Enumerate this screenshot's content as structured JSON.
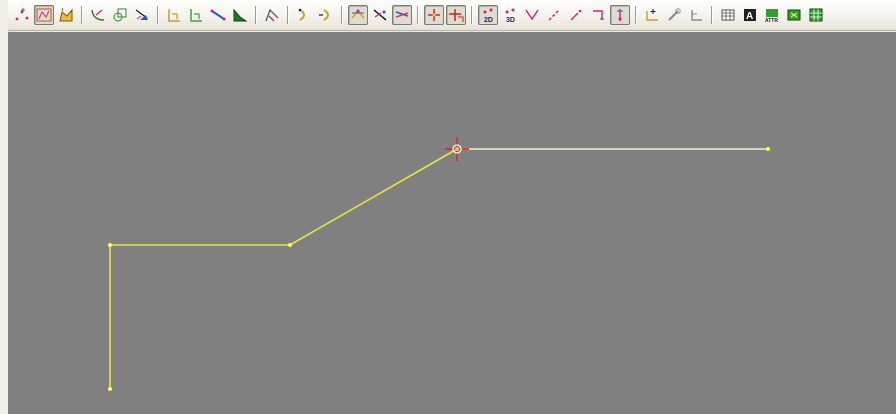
{
  "colors": {
    "canvas_background": "#808080",
    "polyline_color": "#e6e63c",
    "selected_segment_color": "#f0f0b0",
    "vertex_color": "#ffff40",
    "cursor_color": "#e02020"
  },
  "toolbar": {
    "groups": [
      [
        {
          "name": "digitize-points-tool",
          "icon": "points-icon"
        },
        {
          "name": "digitize-polyline-tool",
          "icon": "polyline-icon",
          "active": true
        },
        {
          "name": "digitize-polygon-tool",
          "icon": "polygon-icon"
        }
      ],
      [
        {
          "name": "digitize-curve-tool",
          "icon": "curve-icon"
        },
        {
          "name": "digitize-freehand-tool",
          "icon": "freehand-icon"
        },
        {
          "name": "edit-vertices-tool",
          "icon": "edit-vertices-icon"
        }
      ],
      [
        {
          "name": "rectangle-tool",
          "icon": "rectangle-icon"
        },
        {
          "name": "rectangle-rotated-tool",
          "icon": "rotated-rectangle-icon"
        },
        {
          "name": "line-segment-tool",
          "icon": "line-segment-icon"
        },
        {
          "name": "fill-area-tool",
          "icon": "fill-area-icon"
        }
      ],
      [
        {
          "name": "arc-tool",
          "icon": "arc-icon"
        }
      ],
      [
        {
          "name": "close-shape-tool",
          "icon": "close-shape-icon"
        },
        {
          "name": "open-shape-tool",
          "icon": "open-shape-icon"
        }
      ],
      [
        {
          "name": "snap-to-feature-tool",
          "icon": "snap-feature-icon",
          "active": true
        },
        {
          "name": "snap-to-vertex-tool",
          "icon": "snap-vertex-icon"
        },
        {
          "name": "snap-to-line-tool",
          "icon": "snap-line-icon",
          "active": true
        }
      ],
      [
        {
          "name": "crosshair-tool",
          "icon": "crosshair-icon",
          "active": true
        },
        {
          "name": "crosshair-offset-tool",
          "icon": "crosshair-offset-icon",
          "active": true
        }
      ],
      [
        {
          "name": "mode-2d-tool",
          "icon": "mode-2d-icon",
          "active": true
        },
        {
          "name": "mode-3d-tool",
          "icon": "mode-3d-icon"
        },
        {
          "name": "vertex-join-tool",
          "icon": "vertex-join-icon"
        },
        {
          "name": "line-extend-tool",
          "icon": "line-extend-icon"
        },
        {
          "name": "line-trim-tool",
          "icon": "line-trim-icon"
        },
        {
          "name": "corner-tool",
          "icon": "corner-icon"
        },
        {
          "name": "insert-vertex-tool",
          "icon": "insert-vertex-icon",
          "active": true
        }
      ],
      [
        {
          "name": "add-node-tool",
          "icon": "add-node-icon"
        },
        {
          "name": "pen-tool",
          "icon": "pen-icon"
        },
        {
          "name": "angle-tool",
          "icon": "angle-icon"
        }
      ],
      [
        {
          "name": "attribute-table-tool",
          "icon": "table-icon"
        },
        {
          "name": "label-tool",
          "icon": "label-a-icon"
        },
        {
          "name": "attributes-tool",
          "icon": "attributes-icon"
        },
        {
          "name": "select-by-attribute-tool",
          "icon": "select-attribute-icon"
        },
        {
          "name": "grid-tool",
          "icon": "grid-icon"
        }
      ]
    ]
  }
}
